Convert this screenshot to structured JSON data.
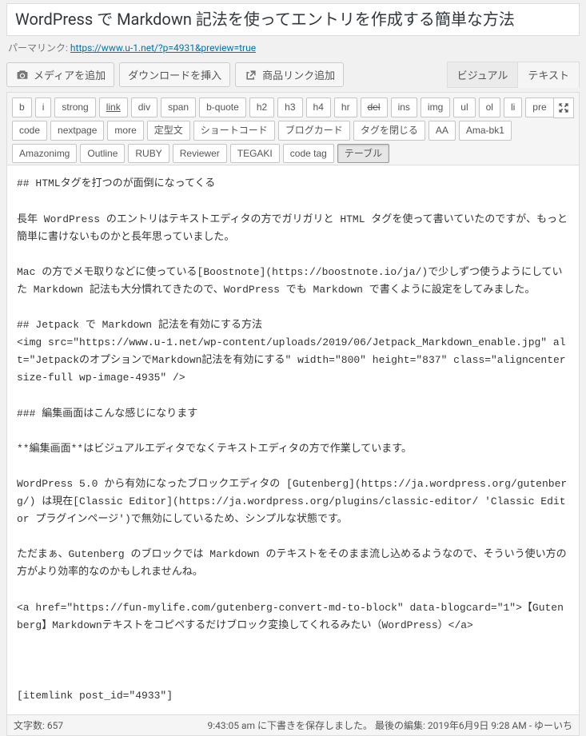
{
  "title": "WordPress で Markdown 記法を使ってエントリを作成する簡単な方法",
  "permalink": {
    "label": "パーマリンク:",
    "url": "https://www.u-1.net/?p=4931&preview=true"
  },
  "media_buttons": {
    "add_media": "メディアを追加",
    "insert_download": "ダウンロードを挿入",
    "product_link": "商品リンク追加"
  },
  "editor_tabs": {
    "visual": "ビジュアル",
    "text": "テキスト",
    "active": "text"
  },
  "quicktags": [
    {
      "label": "b",
      "style": ""
    },
    {
      "label": "i",
      "style": ""
    },
    {
      "label": "strong",
      "style": ""
    },
    {
      "label": "link",
      "style": "ul"
    },
    {
      "label": "div",
      "style": ""
    },
    {
      "label": "span",
      "style": ""
    },
    {
      "label": "b-quote",
      "style": ""
    },
    {
      "label": "h2",
      "style": ""
    },
    {
      "label": "h3",
      "style": ""
    },
    {
      "label": "h4",
      "style": ""
    },
    {
      "label": "hr",
      "style": ""
    },
    {
      "label": "del",
      "style": "strike"
    },
    {
      "label": "ins",
      "style": ""
    },
    {
      "label": "img",
      "style": ""
    },
    {
      "label": "ul",
      "style": ""
    },
    {
      "label": "ol",
      "style": ""
    },
    {
      "label": "li",
      "style": ""
    },
    {
      "label": "pre",
      "style": ""
    },
    {
      "label": "code",
      "style": ""
    },
    {
      "label": "nextpage",
      "style": ""
    },
    {
      "label": "more",
      "style": ""
    },
    {
      "label": "定型文",
      "style": ""
    },
    {
      "label": "ショートコード",
      "style": ""
    },
    {
      "label": "ブログカード",
      "style": ""
    },
    {
      "label": "タグを閉じる",
      "style": ""
    },
    {
      "label": "AA",
      "style": ""
    },
    {
      "label": "Ama-bk1",
      "style": ""
    },
    {
      "label": "Amazonimg",
      "style": ""
    },
    {
      "label": "Outline",
      "style": ""
    },
    {
      "label": "RUBY",
      "style": ""
    },
    {
      "label": "Reviewer",
      "style": ""
    },
    {
      "label": "TEGAKI",
      "style": ""
    },
    {
      "label": "code tag",
      "style": ""
    },
    {
      "label": "テーブル",
      "style": "",
      "active": true
    }
  ],
  "content": "## HTMLタグを打つのが面倒になってくる\n\n長年 WordPress のエントリはテキストエディタの方でガリガリと HTML タグを使って書いていたのですが、もっと簡単に書けないものかと長年思っていました。\n\nMac の方でメモ取りなどに使っている[Boostnote](https://boostnote.io/ja/)で少しずつ使うようにしていた Markdown 記法も大分慣れてきたので、WordPress でも Markdown で書くように設定をしてみました。\n\n## Jetpack で Markdown 記法を有効にする方法\n<img src=\"https://www.u-1.net/wp-content/uploads/2019/06/Jetpack_Markdown_enable.jpg\" alt=\"JetpackのオプションでMarkdown記法を有効にする\" width=\"800\" height=\"837\" class=\"aligncenter size-full wp-image-4935\" />\n\n### 編集画面はこんな感じになります\n\n**編集画面**はビジュアルエディタでなくテキストエディタの方で作業しています。\n\nWordPress 5.0 から有効になったブロックエディタの [Gutenberg](https://ja.wordpress.org/gutenberg/) は現在[Classic Editor](https://ja.wordpress.org/plugins/classic-editor/ 'Classic Editor プラグインページ')で無効にしているため、シンプルな状態です。\n\nただまぁ、Gutenberg のブロックでは Markdown のテキストをそのまま流し込めるようなので、そういう使い方の方がより効率的なのかもしれませんね。\n\n<a href=\"https://fun-mylife.com/gutenberg-convert-md-to-block\" data-blogcard=\"1\">【Gutenberg】Markdownテキストをコピペするだけブロック変換してくれるみたい（WordPress）</a>\n\n\n\n[itemlink post_id=\"4933\"]",
  "status": {
    "word_count_label": "文字数:",
    "word_count": "657",
    "autosave": "9:43:05 am に下書きを保存しました。",
    "last_edit": "最後の編集: 2019年6月9日 9:28 AM - ゆーいち"
  }
}
